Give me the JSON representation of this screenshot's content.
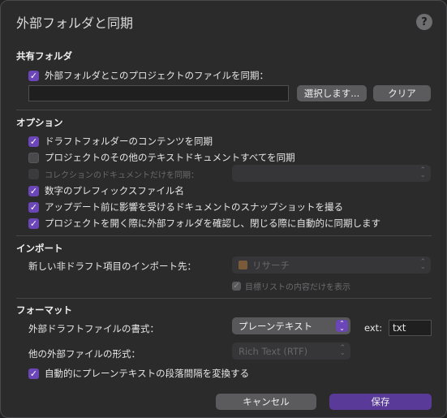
{
  "dialog": {
    "title": "外部フォルダと同期",
    "help": "?"
  },
  "shared": {
    "heading": "共有フォルダ",
    "sync_label": "外部フォルダとこのプロジェクトのファイルを同期：",
    "path_value": "",
    "choose_button": "選択します...",
    "clear_button": "クリア"
  },
  "options": {
    "heading": "オプション",
    "items": [
      {
        "label": "ドラフトフォルダーのコンテンツを同期",
        "checked": true
      },
      {
        "label": "プロジェクトのその他のテキストドキュメントすべてを同期",
        "checked": false
      },
      {
        "label": "コレクションのドキュメントだけを同期：",
        "checked": false,
        "disabled": true
      },
      {
        "label": "数字のプレフィックスファイル名",
        "checked": true
      },
      {
        "label": "アップデート前に影響を受けるドキュメントのスナップショットを撮る",
        "checked": true
      },
      {
        "label": "プロジェクトを開く際に外部フォルダを確認し、閉じる際に自動的に同期します",
        "checked": true
      }
    ],
    "collection_select": ""
  },
  "import": {
    "heading": "インポート",
    "dest_label": "新しい非ドラフト項目のインポート先：",
    "dest_value": "リサーチ",
    "only_checklist": "目標リストの内容だけを表示"
  },
  "format": {
    "heading": "フォーマット",
    "draft_format_label": "外部ドラフトファイルの書式：",
    "draft_format_value": "プレーンテキスト",
    "ext_label": "ext:",
    "ext_value": "txt",
    "other_format_label": "他の外部ファイルの形式：",
    "other_format_value": "Rich Text (RTF)",
    "convert_label": "自動的にプレーンテキストの段落間隔を変換する"
  },
  "footer": {
    "cancel": "キャンセル",
    "save": "保存"
  },
  "colors": {
    "accent": "#6b46b8",
    "primary_button": "#5a3a99"
  }
}
